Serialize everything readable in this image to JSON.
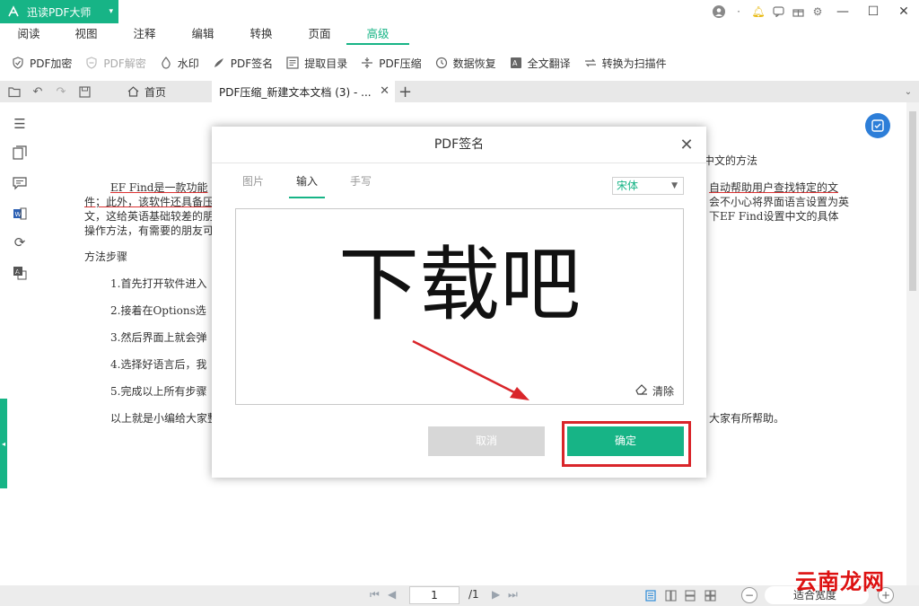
{
  "app": {
    "name": "迅读PDF大师",
    "accent_color": "#17b486"
  },
  "titlebar_icons": [
    "user-icon",
    "dot-icon",
    "bell-icon",
    "chat-icon",
    "gift-icon",
    "gear-icon"
  ],
  "menu": {
    "tabs": [
      "阅读",
      "视图",
      "注释",
      "编辑",
      "转换",
      "页面",
      "高级"
    ],
    "active": "高级"
  },
  "toolbar": {
    "items": [
      {
        "label": "PDF加密",
        "icon": "shield-icon",
        "enabled": true
      },
      {
        "label": "PDF解密",
        "icon": "shield-open-icon",
        "enabled": false
      },
      {
        "label": "水印",
        "icon": "drop-icon",
        "enabled": true
      },
      {
        "label": "PDF签名",
        "icon": "pen-icon",
        "enabled": true
      },
      {
        "label": "提取目录",
        "icon": "list-icon",
        "enabled": true
      },
      {
        "label": "PDF压缩",
        "icon": "compress-icon",
        "enabled": true
      },
      {
        "label": "数据恢复",
        "icon": "restore-icon",
        "enabled": true
      },
      {
        "label": "全文翻译",
        "icon": "translate-icon",
        "enabled": true
      },
      {
        "label": "转换为扫描件",
        "icon": "scan-icon",
        "enabled": true
      }
    ]
  },
  "doc_tabs": {
    "home": "首页",
    "active": "PDF压缩_新建文本文档 (3) - ..."
  },
  "document": {
    "title_right": "中文的方法",
    "para1_line1_left": "EF Find是一款功能",
    "para1_line1_right": "自动帮助用户查找特定的文",
    "para1_line2_left": "件；此外，该软件还具备压",
    "para1_line2_right": "会不小心将界面语言设置为英",
    "para1_line3_left": "文，这给英语基础较差的朋",
    "para1_line3_right": "下EF Find设置中文的具体",
    "para1_line4_left": "操作方法，有需要的朋友可",
    "section": "方法步骤",
    "steps": [
      "1.首先打开软件进入",
      "2.接着在Options选",
      "3.然后界面上就会弹",
      "4.选择好语言后，我",
      "5.完成以上所有步骤"
    ],
    "closing_left": "以上就是小编给大家整",
    "closing_right": "大家有所帮助。"
  },
  "dialog": {
    "title": "PDF签名",
    "tabs": [
      "图片",
      "输入",
      "手写"
    ],
    "active_tab": "输入",
    "font": "宋体",
    "signature_text": "下载吧",
    "clear_label": "清除",
    "cancel_label": "取消",
    "ok_label": "确定"
  },
  "bottombar": {
    "page_current": "1",
    "page_total": "/1",
    "zoom": "适合宽度"
  },
  "watermark": "云南龙网"
}
